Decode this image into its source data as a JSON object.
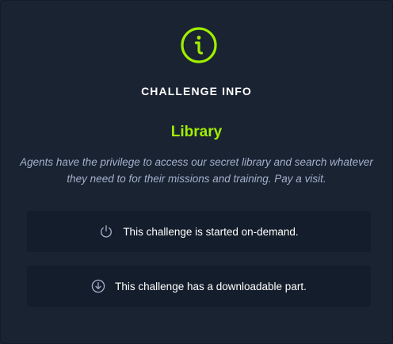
{
  "panel": {
    "icon": "info-circle-icon",
    "heading": "CHALLENGE INFO",
    "challenge_name": "Library",
    "description": "Agents have the privilege to access our secret library and search whatever they need to for their missions and training. Pay a visit."
  },
  "cards": [
    {
      "icon": "power-icon",
      "text": "This challenge is started on-demand."
    },
    {
      "icon": "download-icon",
      "text": "This challenge has a downloadable part."
    }
  ],
  "colors": {
    "background": "#1a2332",
    "card_background": "#141d2b",
    "accent": "#9fef00",
    "description_text": "#a4b1cd",
    "icon_muted": "#a4b1cd"
  }
}
